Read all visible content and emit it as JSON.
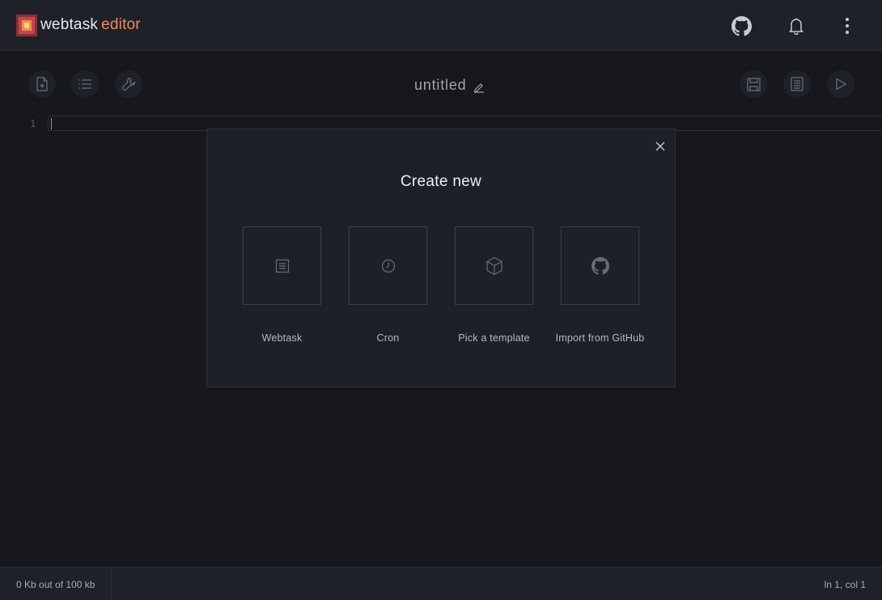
{
  "header": {
    "brand_main": "webtask",
    "brand_sub": "editor",
    "icons": [
      "webtask-logo-icon",
      "github-icon",
      "bell-icon",
      "more-vertical-icon"
    ]
  },
  "toolbar": {
    "left_buttons": [
      "new-file-icon",
      "list-icon",
      "wrench-icon"
    ],
    "right_buttons": [
      "save-icon",
      "document-icon",
      "play-icon"
    ],
    "title": "untitled"
  },
  "editor": {
    "line_number": "1"
  },
  "modal": {
    "title": "Create new",
    "options": [
      {
        "label": "Webtask",
        "icon": "document-icon"
      },
      {
        "label": "Cron",
        "icon": "clock-icon"
      },
      {
        "label": "Pick a template",
        "icon": "cube-icon"
      },
      {
        "label": "Import from GitHub",
        "icon": "github-icon"
      }
    ]
  },
  "status": {
    "usage": "0 Kb out of 100 kb",
    "position": "ln 1, col 1"
  },
  "colors": {
    "background": "#17181e",
    "panel": "#1f2129",
    "accent": "#ee8d55"
  }
}
